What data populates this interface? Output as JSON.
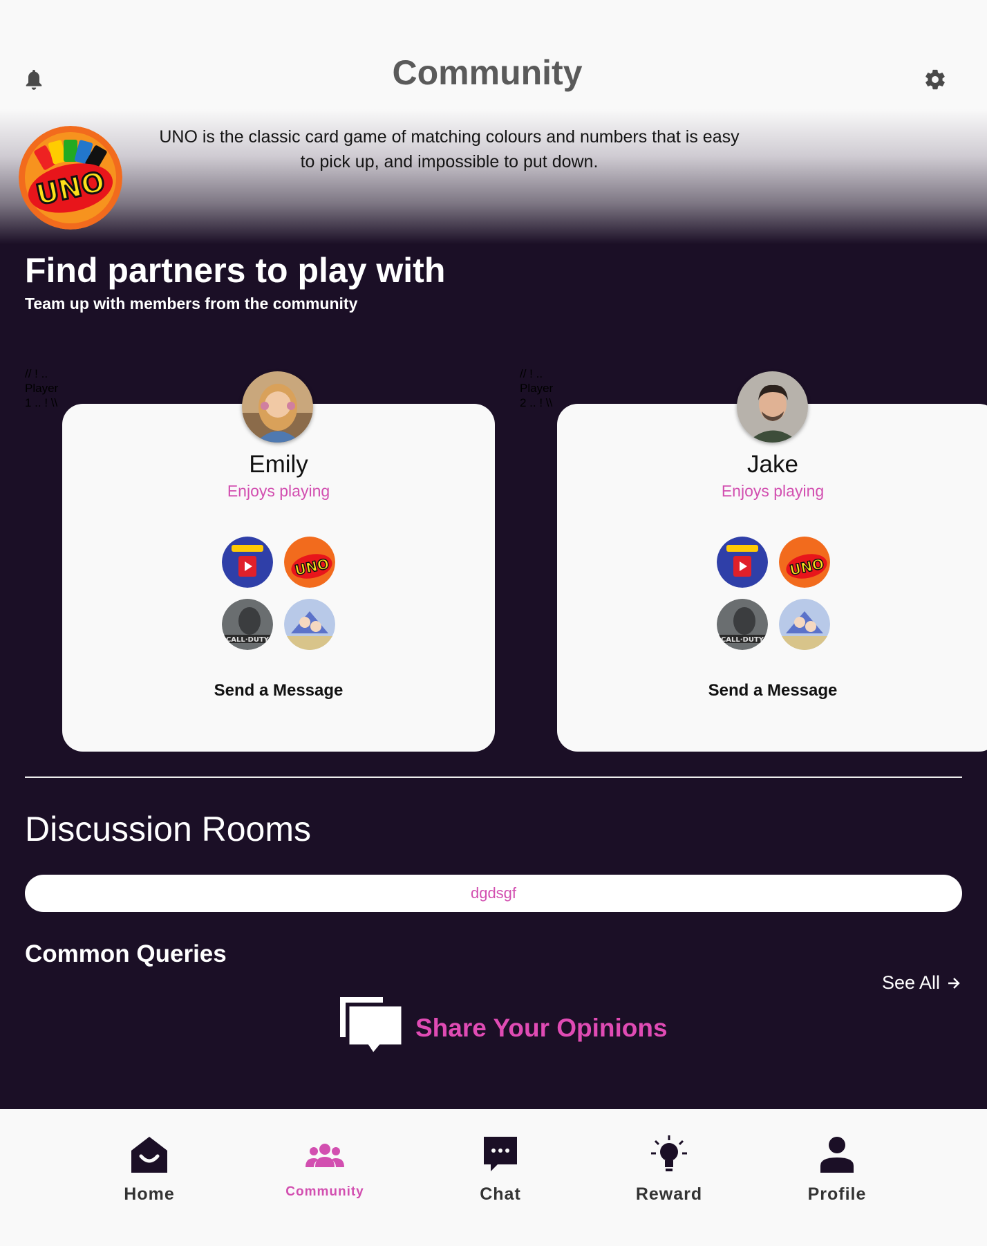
{
  "header": {
    "title": "Community",
    "notifications_icon": "bell-icon",
    "settings_icon": "gear-icon"
  },
  "banner": {
    "logo_icon": "uno-logo",
    "description": "UNO is the classic card game of matching colours and numbers that is easy to pick up, and impossible to put down."
  },
  "partners": {
    "title": "Find partners to play with",
    "subtitle": "Team up with members from the community",
    "players": [
      {
        "comment": "// ! .. Player 1 .. ! \\\\",
        "name": "Emily",
        "enjoys_label": "Enjoys playing",
        "games": [
          "pokemon-tcg",
          "uno",
          "call-of-duty",
          "anime-game"
        ],
        "send_label": "Send a Message"
      },
      {
        "comment": "// ! .. Player 2 .. ! \\\\",
        "name": "Jake",
        "enjoys_label": "Enjoys playing",
        "games": [
          "pokemon-tcg",
          "uno",
          "call-of-duty",
          "anime-game"
        ],
        "send_label": "Send a Message"
      }
    ]
  },
  "discussion": {
    "title": "Discussion Rooms",
    "room_pill": "dgdsgf"
  },
  "common_queries": {
    "title": "Common Queries",
    "see_all": "See All",
    "share_label": "Share Your Opinions"
  },
  "nav": {
    "items": [
      {
        "label": "Home",
        "icon": "home-icon",
        "active": false
      },
      {
        "label": "Community",
        "icon": "community-icon",
        "active": true
      },
      {
        "label": "Chat",
        "icon": "chat-icon",
        "active": false
      },
      {
        "label": "Reward",
        "icon": "reward-icon",
        "active": false
      },
      {
        "label": "Profile",
        "icon": "profile-icon",
        "active": false
      }
    ]
  },
  "colors": {
    "background": "#1b0f26",
    "accent": "#d24fb0",
    "surface": "#f9f9f9"
  }
}
